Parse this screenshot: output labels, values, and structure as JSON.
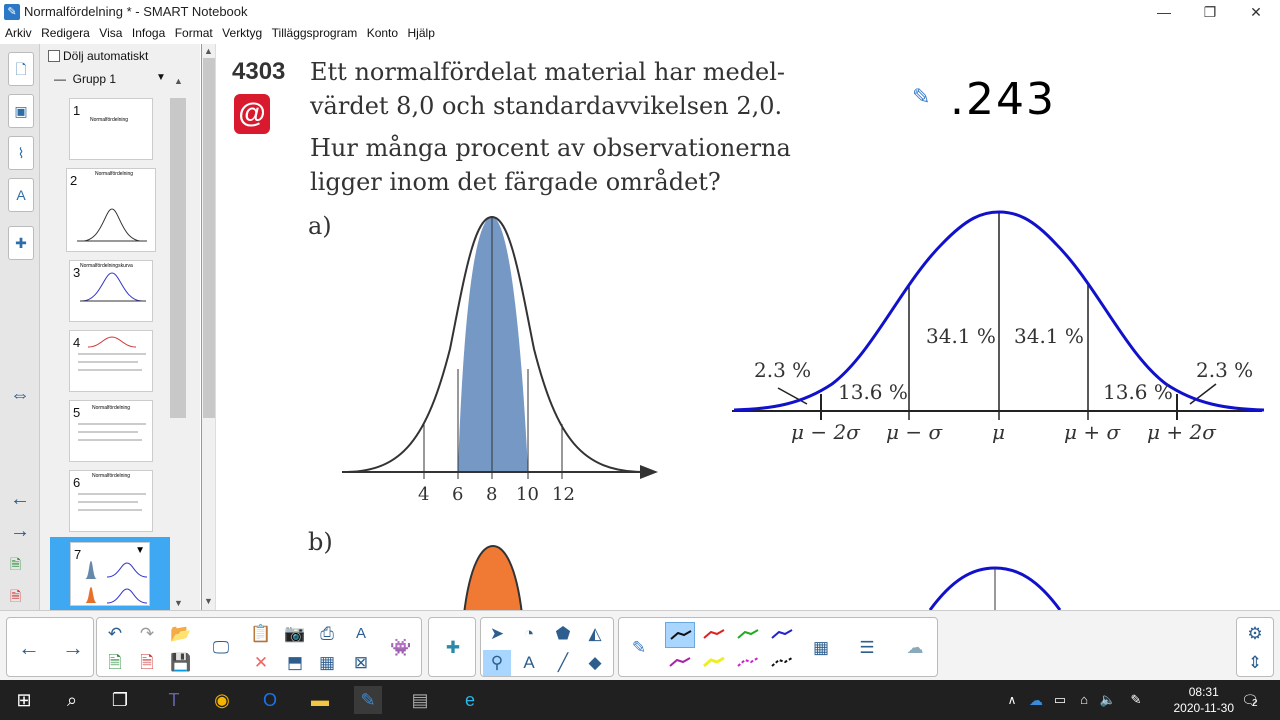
{
  "window": {
    "title": "Normalfördelning * - SMART Notebook",
    "app_icon": "smart-notebook-icon"
  },
  "menu": [
    "Arkiv",
    "Redigera",
    "Visa",
    "Infoga",
    "Format",
    "Verktyg",
    "Tilläggsprogram",
    "Konto",
    "Hjälp"
  ],
  "sidebar": {
    "hide_label": "Dölj automatiskt",
    "group_label": "Grupp 1",
    "pages": [
      {
        "num": "1",
        "caption": "Normalfördelning"
      },
      {
        "num": "2",
        "caption": "Normalfördelning"
      },
      {
        "num": "3",
        "caption": "Normalfördelningskurva"
      },
      {
        "num": "4",
        "caption": ""
      },
      {
        "num": "5",
        "caption": "Normalfördelning"
      },
      {
        "num": "6",
        "caption": "Normalfördelning"
      },
      {
        "num": "7",
        "caption": ""
      }
    ]
  },
  "page": {
    "problem_number": "4303",
    "problem_text": [
      "Ett normalfördelat material har medel-",
      "värdet 8,0 och standardavvikelsen 2,0.",
      "Hur många procent av observationerna",
      "ligger inom det färgade området?"
    ],
    "part_a": "a)",
    "part_b": "b)",
    "handwritten_answer": ".243",
    "axis_a_ticks": [
      "4",
      "6",
      "8",
      "10",
      "12"
    ],
    "curve_labels": {
      "pct_left_tail": "2.3 %",
      "pct_left_mid": "13.6 %",
      "pct_center_left": "34.1 %",
      "pct_center_right": "34.1 %",
      "pct_right_mid": "13.6 %",
      "pct_right_tail": "2.3 %",
      "mu_minus_2s": "μ − 2σ",
      "mu_minus_s": "μ − σ",
      "mu": "μ",
      "mu_plus_s": "μ + σ",
      "mu_plus_2s": "μ + 2σ"
    }
  },
  "taskbar": {
    "time": "08:31",
    "date": "2020-11-30",
    "notif_count": "2"
  }
}
